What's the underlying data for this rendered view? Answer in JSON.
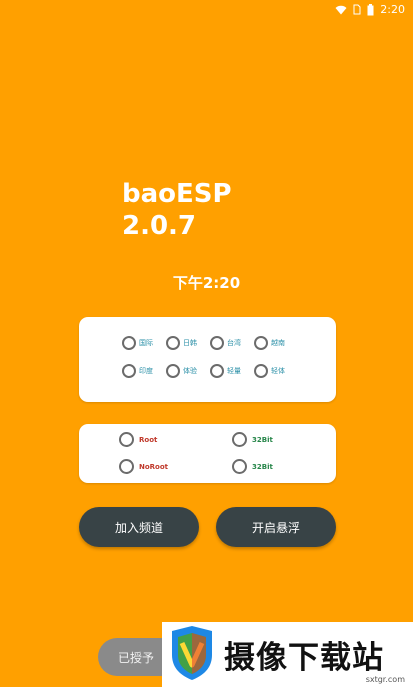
{
  "status_bar": {
    "time": "2:20",
    "icons": [
      "wifi-icon",
      "sim-icon",
      "battery-icon"
    ]
  },
  "app": {
    "name": "baoESP",
    "version": "2.0.7",
    "clock": "下午2:20"
  },
  "regions": [
    {
      "label": "国际"
    },
    {
      "label": "日韩"
    },
    {
      "label": "台湾"
    },
    {
      "label": "越南"
    },
    {
      "label": "印度"
    },
    {
      "label": "体验"
    },
    {
      "label": "轻量"
    },
    {
      "label": "轻体"
    }
  ],
  "modes": [
    {
      "label": "Root"
    },
    {
      "label": "32Bit"
    },
    {
      "label": "NoRoot"
    },
    {
      "label": "32Bit"
    }
  ],
  "buttons": {
    "join_channel": "加入频道",
    "open_float": "开启悬浮",
    "granted": "已授予"
  },
  "watermark": {
    "text": "摄像下载站",
    "url": "sxtgr.com"
  },
  "colors": {
    "background": "#FFA000",
    "card": "#FFFFFF",
    "button": "#384346",
    "region_label": "#2A8FA7",
    "mode_red": "#C0392B",
    "mode_green": "#27864A"
  }
}
